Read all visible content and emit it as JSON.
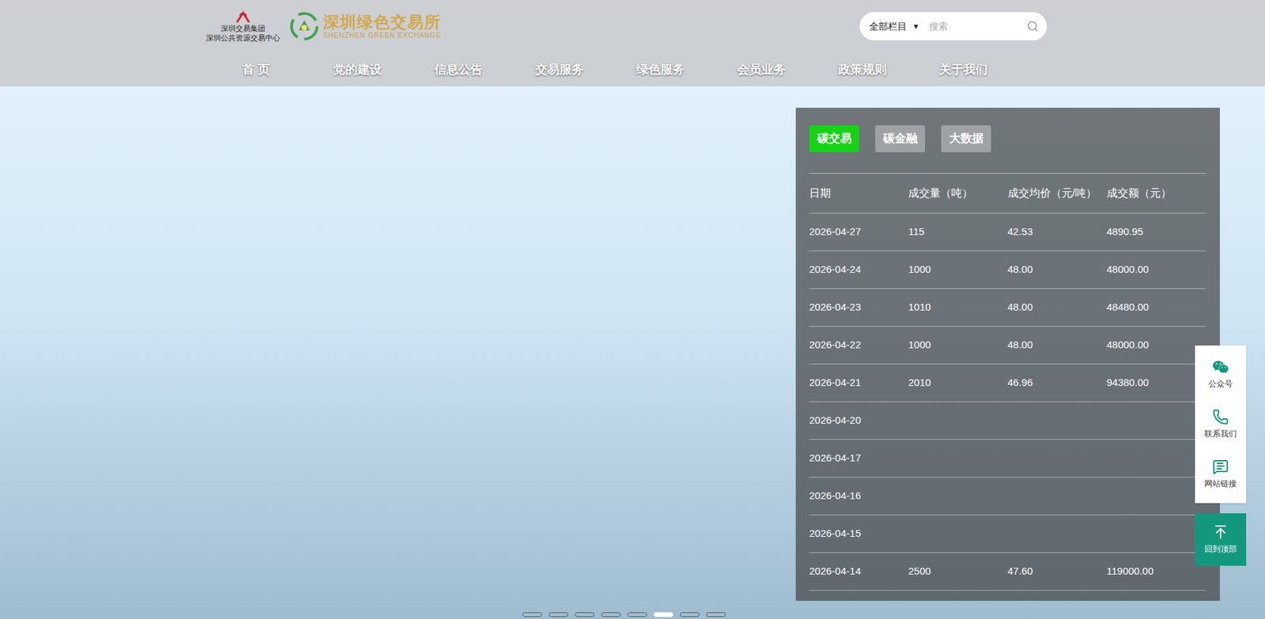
{
  "logos": {
    "group": {
      "lines": [
        "深圳交易集团",
        "深圳公共资源交易中心"
      ]
    },
    "exchange": {
      "name": "深圳绿色交易所",
      "english": "SHENZHEN GREEN EXCHANGE"
    }
  },
  "search": {
    "scope": "全部栏目",
    "arrow": "▼",
    "placeholder": "搜索"
  },
  "nav": [
    "首 页",
    "党的建设",
    "信息公告",
    "交易服务",
    "绿色服务",
    "会员业务",
    "政策规则",
    "关于我们"
  ],
  "panel": {
    "tabs": [
      {
        "label": "碳交易",
        "selected": true
      },
      {
        "label": "碳金融",
        "selected": false
      },
      {
        "label": "大数据",
        "selected": false
      }
    ],
    "columns": [
      "日期",
      "成交量（吨）",
      "成交均价（元/吨）",
      "成交额（元）"
    ],
    "rows": [
      [
        "2026-04-27",
        "115",
        "42.53",
        "4890.95"
      ],
      [
        "2026-04-24",
        "1000",
        "48.00",
        "48000.00"
      ],
      [
        "2026-04-23",
        "1010",
        "48.00",
        "48480.00"
      ],
      [
        "2026-04-22",
        "1000",
        "48.00",
        "48000.00"
      ],
      [
        "2026-04-21",
        "2010",
        "46.96",
        "94380.00"
      ],
      [
        "2026-04-20",
        "",
        "",
        ""
      ],
      [
        "2026-04-17",
        "",
        "",
        ""
      ],
      [
        "2026-04-16",
        "",
        "",
        ""
      ],
      [
        "2026-04-15",
        "",
        "",
        ""
      ],
      [
        "2026-04-14",
        "2500",
        "47.60",
        "119000.00"
      ]
    ]
  },
  "floating": [
    {
      "label": "公众号"
    },
    {
      "label": "联系我们"
    },
    {
      "label": "网站链接"
    }
  ],
  "back_to_top": "回到顶部",
  "carousel": {
    "dots": [
      {
        "selected": false
      },
      {
        "selected": false
      },
      {
        "selected": false
      },
      {
        "selected": false
      },
      {
        "selected": false
      },
      {
        "selected": true
      },
      {
        "selected": false
      },
      {
        "selected": false
      }
    ]
  }
}
